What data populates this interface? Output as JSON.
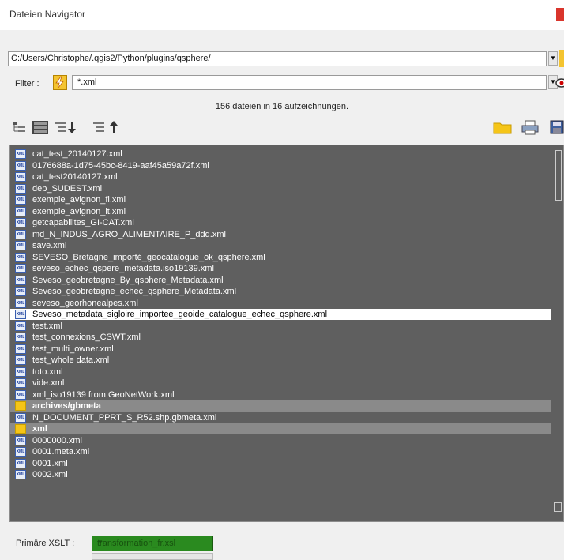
{
  "window": {
    "title": "Dateien Navigator"
  },
  "path": {
    "value": "C:/Users/Christophe/.qgis2/Python/plugins/qsphere/"
  },
  "filter": {
    "label": "Filter :",
    "value": "*.xml"
  },
  "status": {
    "count_text": "156 dateien in 16 aufzeichnungen."
  },
  "toolbar": {
    "left_icons": [
      "tree-collapse-icon",
      "list-view-icon",
      "sort-descending-icon",
      "sort-ascending-icon"
    ],
    "right_icons": [
      "folder-icon",
      "print-icon",
      "save-icon"
    ]
  },
  "files": [
    {
      "label": "cat_test_20140127.xml",
      "type": "file"
    },
    {
      "label": "0176688a-1d75-45bc-8419-aaf45a59a72f.xml",
      "type": "file"
    },
    {
      "label": "cat_test20140127.xml",
      "type": "file"
    },
    {
      "label": "dep_SUDEST.xml",
      "type": "file"
    },
    {
      "label": "exemple_avignon_fi.xml",
      "type": "file"
    },
    {
      "label": "exemple_avignon_it.xml",
      "type": "file"
    },
    {
      "label": "getcapabilites_GI-CAT.xml",
      "type": "file"
    },
    {
      "label": "md_N_INDUS_AGRO_ALIMENTAIRE_P_ddd.xml",
      "type": "file"
    },
    {
      "label": "save.xml",
      "type": "file"
    },
    {
      "label": "SEVESO_Bretagne_importé_geocatalogue_ok_qsphere.xml",
      "type": "file"
    },
    {
      "label": "seveso_echec_qspere_metadata.iso19139.xml",
      "type": "file"
    },
    {
      "label": "Seveso_geobretagne_By_qsphere_Metadata.xml",
      "type": "file"
    },
    {
      "label": "Seveso_geobretagne_echec_qsphere_Metadata.xml",
      "type": "file"
    },
    {
      "label": "seveso_georhonealpes.xml",
      "type": "file"
    },
    {
      "label": "Seveso_metadata_sigloire_importee_geoide_catalogue_echec_qsphere.xml",
      "type": "file",
      "selected": true
    },
    {
      "label": "test.xml",
      "type": "file"
    },
    {
      "label": "test_connexions_CSWT.xml",
      "type": "file"
    },
    {
      "label": "test_multi_owner.xml",
      "type": "file"
    },
    {
      "label": "test_whole data.xml",
      "type": "file"
    },
    {
      "label": "toto.xml",
      "type": "file"
    },
    {
      "label": "vide.xml",
      "type": "file"
    },
    {
      "label": "xml_iso19139 from GeoNetWork.xml",
      "type": "file"
    },
    {
      "label": "archives/gbmeta",
      "type": "folder"
    },
    {
      "label": "N_DOCUMENT_PPRT_S_R52.shp.gbmeta.xml",
      "type": "file"
    },
    {
      "label": "xml",
      "type": "folder"
    },
    {
      "label": "0000000.xml",
      "type": "file"
    },
    {
      "label": "0001.meta.xml",
      "type": "file"
    },
    {
      "label": "0001.xml",
      "type": "file"
    },
    {
      "label": "0002.xml",
      "type": "file"
    }
  ],
  "xslt": {
    "label": "Primäre XSLT :",
    "value": "transformation_fr.xsl"
  },
  "colors": {
    "list_bg": "#5f5f5f",
    "selected_bg": "#ffffff",
    "folder_bg": "#8a8a8a",
    "xslt_bg": "#2a8a1f"
  }
}
